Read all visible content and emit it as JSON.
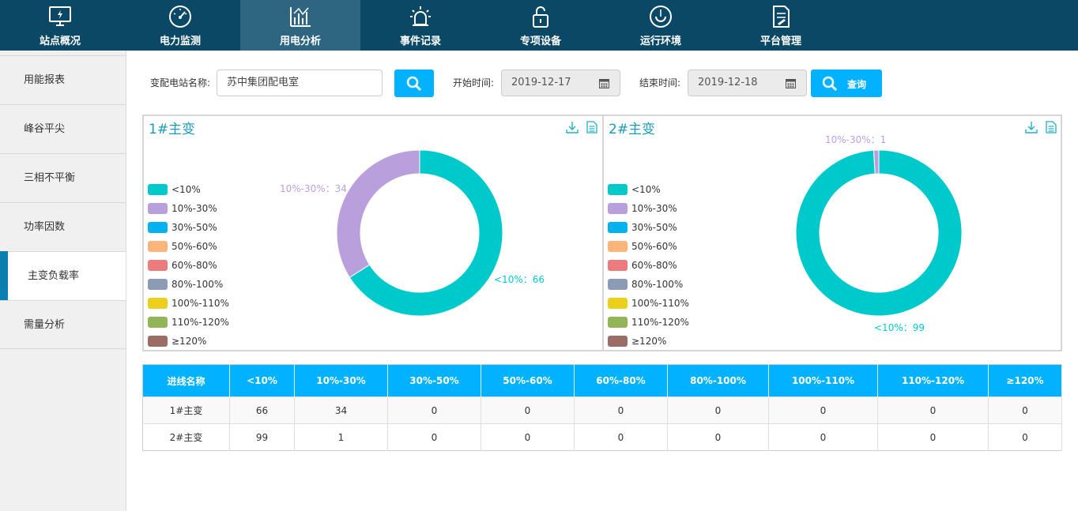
{
  "nav": [
    {
      "label": "站点概况",
      "icon": "monitor-icon"
    },
    {
      "label": "电力监测",
      "icon": "gauge-icon"
    },
    {
      "label": "用电分析",
      "icon": "chart-icon"
    },
    {
      "label": "事件记录",
      "icon": "alarm-icon"
    },
    {
      "label": "专项设备",
      "icon": "lock-icon"
    },
    {
      "label": "运行环境",
      "icon": "environment-icon"
    },
    {
      "label": "平台管理",
      "icon": "document-icon"
    }
  ],
  "nav_active": 2,
  "sidebar": [
    {
      "label": "用能报表"
    },
    {
      "label": "峰谷平尖"
    },
    {
      "label": "三相不平衡"
    },
    {
      "label": "功率因数"
    },
    {
      "label": "主变负载率"
    },
    {
      "label": "需量分析"
    }
  ],
  "sidebar_active": 4,
  "filter": {
    "station_label": "变配电站名称:",
    "station_value": "苏中集团配电室",
    "start_label": "开始时间:",
    "start_value": "2019-12-17",
    "end_label": "结束时间:",
    "end_value": "2019-12-18",
    "query_label": "查询"
  },
  "legend": [
    {
      "name": "<10%",
      "color": "#00c9cc"
    },
    {
      "name": "10%-30%",
      "color": "#b9a0dd"
    },
    {
      "name": "30%-50%",
      "color": "#00b2ee"
    },
    {
      "name": "50%-60%",
      "color": "#fbb57a"
    },
    {
      "name": "60%-80%",
      "color": "#ed7b7d"
    },
    {
      "name": "80%-100%",
      "color": "#8b9ab5"
    },
    {
      "name": "100%-110%",
      "color": "#eccf1a"
    },
    {
      "name": "110%-120%",
      "color": "#92b657"
    },
    {
      "name": "≥120%",
      "color": "#9b6b66"
    }
  ],
  "chart_data": [
    {
      "type": "pie",
      "title": "1#主变",
      "categories": [
        "<10%",
        "10%-30%",
        "30%-50%",
        "50%-60%",
        "60%-80%",
        "80%-100%",
        "100%-110%",
        "110%-120%",
        "≥120%"
      ],
      "values": [
        66,
        34,
        0,
        0,
        0,
        0,
        0,
        0,
        0
      ],
      "labels": [
        "<10%：66",
        "10%-30%：34"
      ]
    },
    {
      "type": "pie",
      "title": "2#主变",
      "categories": [
        "<10%",
        "10%-30%",
        "30%-50%",
        "50%-60%",
        "60%-80%",
        "80%-100%",
        "100%-110%",
        "110%-120%",
        "≥120%"
      ],
      "values": [
        99,
        1,
        0,
        0,
        0,
        0,
        0,
        0,
        0
      ],
      "labels": [
        "<10%：99",
        "10%-30%：1"
      ]
    }
  ],
  "table": {
    "headers": [
      "进线名称",
      "<10%",
      "10%-30%",
      "30%-50%",
      "50%-60%",
      "60%-80%",
      "80%-100%",
      "100%-110%",
      "110%-120%",
      "≥120%"
    ],
    "rows": [
      [
        "1#主变",
        "66",
        "34",
        "0",
        "0",
        "0",
        "0",
        "0",
        "0",
        "0"
      ],
      [
        "2#主变",
        "99",
        "1",
        "0",
        "0",
        "0",
        "0",
        "0",
        "0",
        "0"
      ]
    ]
  }
}
